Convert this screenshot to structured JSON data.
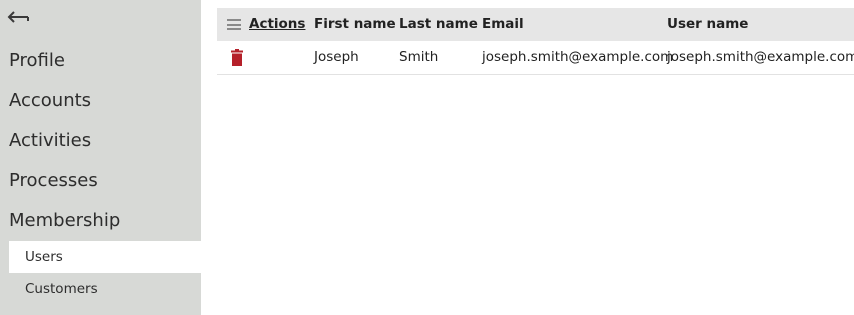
{
  "sidebar": {
    "back_icon": "arrow-left-icon",
    "items": [
      {
        "label": "Profile"
      },
      {
        "label": "Accounts"
      },
      {
        "label": "Activities"
      },
      {
        "label": "Processes"
      },
      {
        "label": "Membership"
      }
    ],
    "sub_items": [
      {
        "label": "Users",
        "active": true
      },
      {
        "label": "Customers",
        "active": false
      }
    ]
  },
  "table": {
    "menu_icon": "hamburger-icon",
    "columns": {
      "actions": "Actions",
      "first_name": "First name",
      "last_name": "Last name",
      "email": "Email",
      "user_name": "User name"
    },
    "rows": [
      {
        "delete_icon": "trash-icon",
        "first_name": "Joseph",
        "last_name": "Smith",
        "email": "joseph.smith@example.com",
        "user_name": "joseph.smith@example.com"
      }
    ]
  },
  "colors": {
    "sidebar_bg": "#d7d9d6",
    "header_bg": "#e6e6e6",
    "delete_red": "#b5202a"
  }
}
